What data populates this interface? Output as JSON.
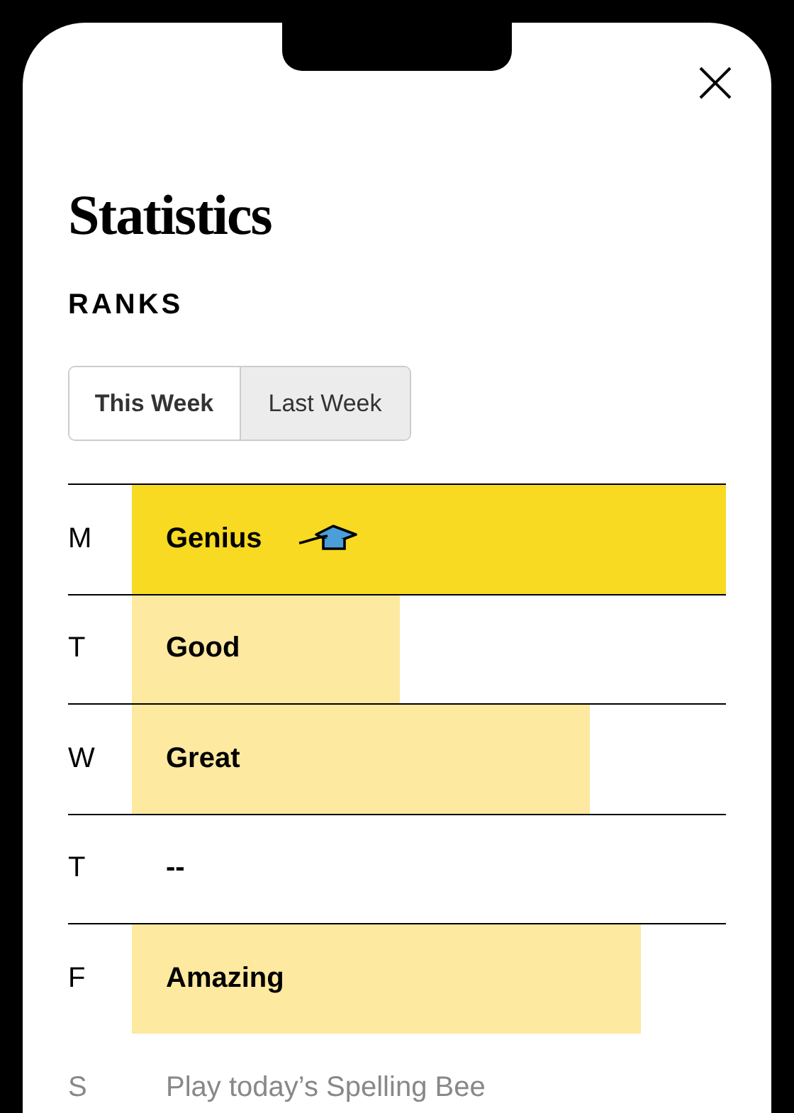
{
  "title": "Statistics",
  "section": "RANKS",
  "tabs": [
    {
      "label": "This Week",
      "selected": true
    },
    {
      "label": "Last Week",
      "selected": false
    }
  ],
  "rows": [
    {
      "day": "M",
      "kind": "genius",
      "rank": "Genius"
    },
    {
      "day": "T",
      "kind": "good",
      "rank": "Good"
    },
    {
      "day": "W",
      "kind": "great",
      "rank": "Great"
    },
    {
      "day": "T",
      "kind": "none",
      "rank": "--"
    },
    {
      "day": "F",
      "kind": "amazing",
      "rank": "Amazing"
    },
    {
      "day": "S",
      "kind": "prompt",
      "rank": "Play today’s Spelling Bee"
    }
  ]
}
